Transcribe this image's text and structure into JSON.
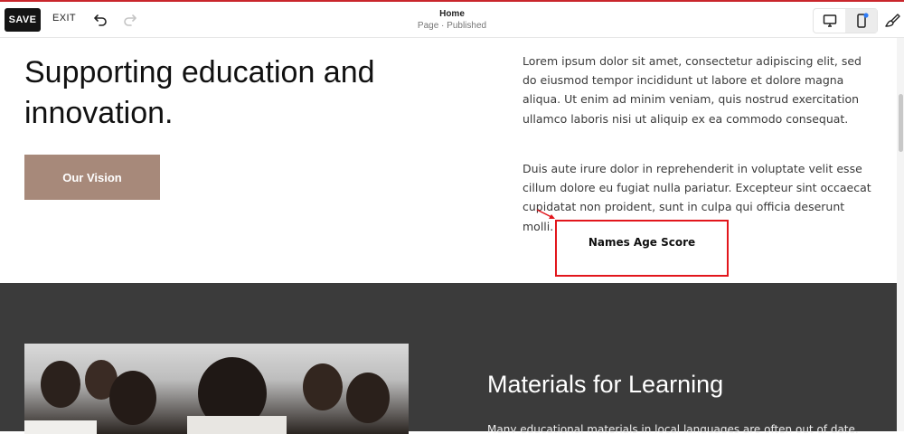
{
  "toolbar": {
    "save_label": "SAVE",
    "exit_label": "EXIT",
    "page_title": "Home",
    "page_status": "Page · Published"
  },
  "hero": {
    "heading": "Supporting education and innovation.",
    "button_label": "Our Vision",
    "paragraph_1": "Lorem ipsum dolor sit amet, consectetur adipiscing elit, sed do eiusmod tempor incididunt ut labore et dolore magna aliqua. Ut enim ad minim veniam, quis nostrud exercitation ullamco laboris nisi ut aliquip ex ea commodo consequat.",
    "paragraph_2": "Duis aute irure dolor in reprehenderit in voluptate velit esse cillum dolore eu fugiat nulla pariatur. Excepteur sint occaecat cupidatat non proident, sunt in culpa qui officia deserunt molli.",
    "table_header": "Names Age Score"
  },
  "materials": {
    "heading": "Materials for Learning",
    "body": "Many educational materials in local languages are often out of date. We work"
  },
  "colors": {
    "accent": "#c9262c",
    "button_brown": "#a7897a",
    "highlight_red": "#e2161c",
    "dark_section": "#3b3b3b"
  },
  "icons": [
    "undo-icon",
    "redo-icon",
    "desktop-icon",
    "mobile-icon",
    "brush-icon",
    "arrow-icon"
  ]
}
